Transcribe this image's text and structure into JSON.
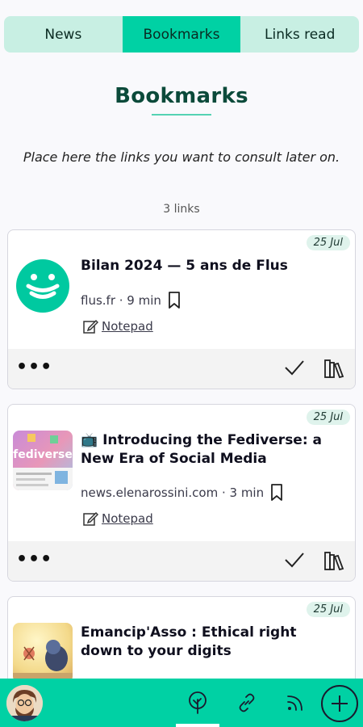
{
  "tabs": [
    {
      "label": "News",
      "active": false
    },
    {
      "label": "Bookmarks",
      "active": true
    },
    {
      "label": "Links read",
      "active": false
    }
  ],
  "page": {
    "title": "Bookmarks",
    "intro": "Place here the links you want to consult later on.",
    "count": "3 links"
  },
  "cards": [
    {
      "date": "25 Jul",
      "title": "Bilan 2024 — 5 ans de Flus",
      "source": "flus.fr · 9 min",
      "notepad_label": "Notepad"
    },
    {
      "date": "25 Jul",
      "title": "📺 Introducing the Fediverse: a New Era of Social Media",
      "source": "news.elenarossini.com · 3 min",
      "notepad_label": "Notepad",
      "thumb_text": "fediverse"
    },
    {
      "date": "25 Jul",
      "title": "Emancip'Asso : Ethical right down to your digits"
    }
  ],
  "actions": {
    "more_label": "•••"
  },
  "icons": {
    "brand": "flus-logo",
    "bookmark": "bookmark-icon",
    "notepad": "edit-icon",
    "check": "check-icon",
    "library": "library-icon",
    "nav": [
      "sprout-icon",
      "link-icon",
      "rss-icon",
      "plus-icon"
    ]
  },
  "colors": {
    "accent": "#00d1a4",
    "tab_bg": "#c8efe3",
    "title": "#0b4a3a"
  }
}
